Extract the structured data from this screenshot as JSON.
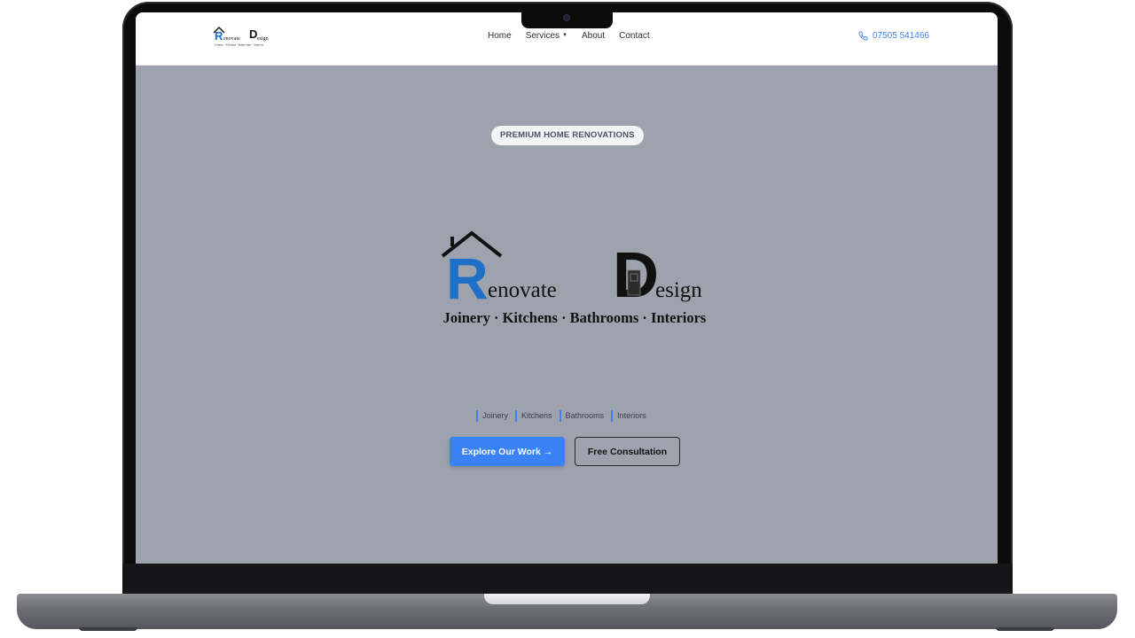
{
  "nav": {
    "logo": {
      "word1_initial": "R",
      "word1_rest": "enovate",
      "word2_initial": "D",
      "word2_rest": "esign",
      "tagline": "Joinery · Kitchens · Bathrooms · Interiors"
    },
    "links": [
      {
        "label": "Home"
      },
      {
        "label": "Services",
        "has_dropdown": true,
        "caret": "▼"
      },
      {
        "label": "About"
      },
      {
        "label": "Contact"
      }
    ],
    "phone": {
      "icon": "phone-icon",
      "number": "07505 541466"
    }
  },
  "hero": {
    "badge": "PREMIUM HOME RENOVATIONS",
    "logo": {
      "word1_initial": "R",
      "word1_rest": "enovate",
      "word2_initial": "D",
      "word2_rest": "esign",
      "tagline": "Joinery · Kitchens · Bathrooms · Interiors"
    },
    "categories": [
      "Joinery",
      "Kitchens",
      "Bathrooms",
      "Interiors"
    ],
    "primary_button": "Explore Our Work →",
    "secondary_button": "Free Consultation"
  },
  "colors": {
    "accent": "#3b82f6",
    "hero_background": "#9da2ad",
    "logo_blue": "#1e6fc8"
  }
}
